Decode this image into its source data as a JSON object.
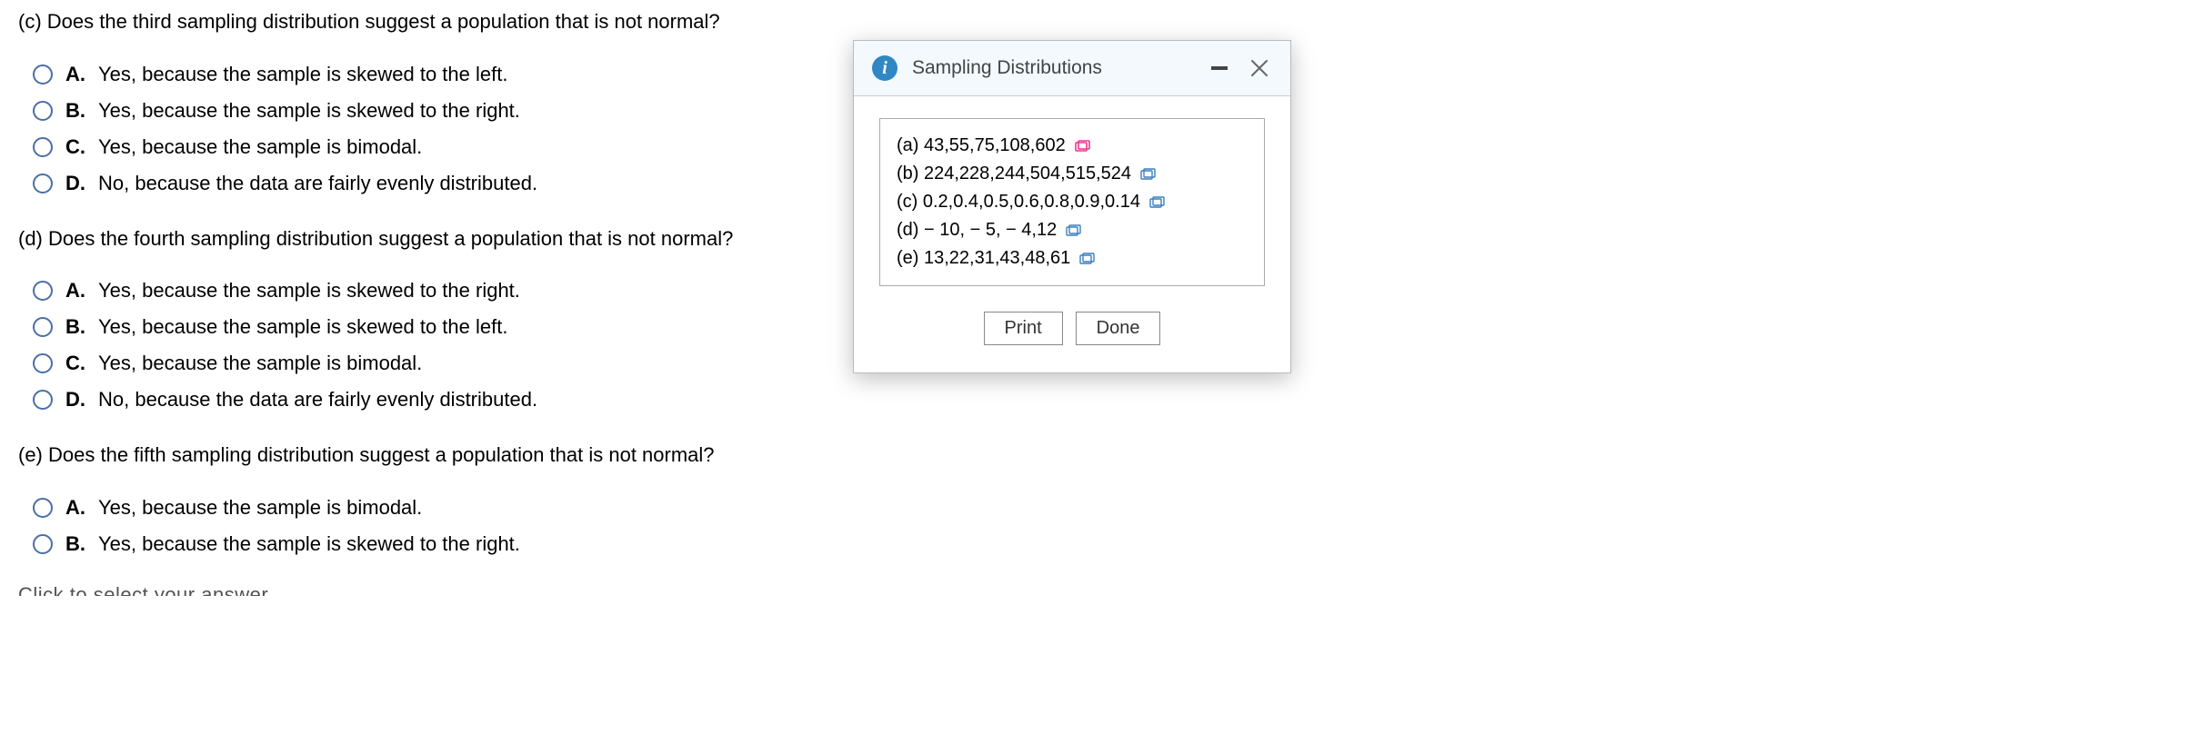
{
  "questions": {
    "c": {
      "prompt": "(c) Does the third sampling distribution suggest a population that is not normal?",
      "opts": {
        "a": {
          "letter": "A.",
          "text": "Yes, because the sample is skewed to the left."
        },
        "b": {
          "letter": "B.",
          "text": "Yes, because the sample is skewed to the right."
        },
        "c": {
          "letter": "C.",
          "text": "Yes, because the sample is bimodal."
        },
        "d": {
          "letter": "D.",
          "text": "No, because the data are fairly evenly distributed."
        }
      }
    },
    "d": {
      "prompt": "(d) Does the fourth sampling distribution suggest a population that is not normal?",
      "opts": {
        "a": {
          "letter": "A.",
          "text": "Yes, because the sample is skewed to the right."
        },
        "b": {
          "letter": "B.",
          "text": "Yes, because the sample is skewed to the left."
        },
        "c": {
          "letter": "C.",
          "text": "Yes, because the sample is bimodal."
        },
        "d": {
          "letter": "D.",
          "text": "No, because the data are fairly evenly distributed."
        }
      }
    },
    "e": {
      "prompt": "(e) Does the fifth sampling distribution suggest a population that is not normal?",
      "opts": {
        "a": {
          "letter": "A.",
          "text": "Yes, because the sample is bimodal."
        },
        "b": {
          "letter": "B.",
          "text": "Yes, because the sample is skewed to the right."
        }
      }
    }
  },
  "cutoff_text": "Click to select your answer",
  "popup": {
    "title": "Sampling Distributions",
    "lines": {
      "a": "(a) 43,55,75,108,602",
      "b": "(b) 224,228,244,504,515,524",
      "c": "(c) 0.2,0.4,0.5,0.6,0.8,0.9,0.14",
      "d": "(d)  − 10, − 5, − 4,12",
      "e": "(e) 13,22,31,43,48,61"
    },
    "print_label": "Print",
    "done_label": "Done"
  },
  "colors": {
    "radio_border": "#4a6ea9",
    "info_bg": "#2f87c4",
    "header_bg": "#f3f9fd",
    "icon_accent": "#e6398f"
  }
}
